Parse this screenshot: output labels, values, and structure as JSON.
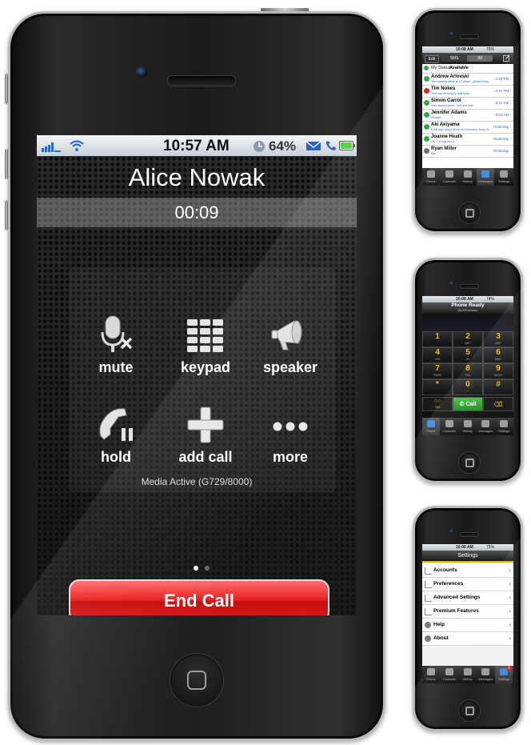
{
  "main_call": {
    "status_bar": {
      "time": "10:57 AM",
      "battery_pct": "64%"
    },
    "caller_name": "Alice Nowak",
    "duration": "00:09",
    "controls": {
      "mute": "mute",
      "keypad": "keypad",
      "speaker": "speaker",
      "hold": "hold",
      "add_call": "add call",
      "more": "more"
    },
    "media_status": "Media Active (G729/8000)",
    "end_call": "End Call",
    "page_indicator": {
      "pages": 2,
      "current": 1
    }
  },
  "messages_screen": {
    "status_time": "10:08 AM",
    "status_battery": "75%",
    "tabs": {
      "edit": "Edit",
      "sms": "SMS",
      "im": "IM"
    },
    "my_status_label": "My Status:",
    "my_status_value": "Available",
    "items": [
      {
        "name": "Andrew Arlovski",
        "preview": "The meeting starts at 10:45am - please bring...",
        "time": "2:48 PM",
        "status": "available"
      },
      {
        "name": "Tim Nokes",
        "preview": "They are arriving by helicopter",
        "time": "2:34 PM",
        "status": "busy"
      },
      {
        "name": "Simon Carrol",
        "preview": "Sure sounds great - see you then",
        "time": "8:24 AM",
        "status": "available"
      },
      {
        "name": "Jennifer Adams",
        "preview": "Finally!!!",
        "time": "8:03 AM",
        "status": "available"
      },
      {
        "name": "Aki Akiyama",
        "preview": "It will take about 40min and includes many of...",
        "time": "Yesterday",
        "status": "available"
      },
      {
        "name": "Joanne Heath",
        "preview": "OK - I'll look into it",
        "time": "Yesterday",
        "status": "available"
      },
      {
        "name": "Ryan Miller",
        "preview": "Bye",
        "time": "Yesterday",
        "status": "offline"
      }
    ],
    "tabbar": [
      "Phone",
      "Contacts",
      "History",
      "Messages",
      "Settings"
    ],
    "selected_tab": "Messages"
  },
  "dialpad_screen": {
    "status_time": "10:09 AM",
    "status_battery": "74%",
    "title": "Phone Ready",
    "subtitle": "My SIP Account",
    "keys": [
      {
        "digit": "1",
        "letters": ""
      },
      {
        "digit": "2",
        "letters": "ABC"
      },
      {
        "digit": "3",
        "letters": "DEF"
      },
      {
        "digit": "4",
        "letters": "GHI"
      },
      {
        "digit": "5",
        "letters": "JKL"
      },
      {
        "digit": "6",
        "letters": "MNO"
      },
      {
        "digit": "7",
        "letters": "PQRS"
      },
      {
        "digit": "8",
        "letters": "TUV"
      },
      {
        "digit": "9",
        "letters": "WXYZ"
      },
      {
        "digit": "*",
        "letters": ""
      },
      {
        "digit": "0",
        "letters": "+"
      },
      {
        "digit": "#",
        "letters": ""
      }
    ],
    "voicemail_label": "VM",
    "call_label": "Call",
    "tabbar": [
      "Phone",
      "Contacts",
      "History",
      "Messages",
      "Settings"
    ],
    "selected_tab": "Phone"
  },
  "settings_screen": {
    "status_time": "10:06 AM",
    "status_battery": "75%",
    "title": "Settings",
    "items": [
      "Accounts",
      "Preferences",
      "Advanced Settings",
      "Premium Features",
      "Help",
      "About"
    ],
    "tabbar": [
      "Phone",
      "Contacts",
      "History",
      "Messages",
      "Settings"
    ],
    "selected_tab": "Settings",
    "settings_badge": "1"
  },
  "colors": {
    "end_call_red": "#e01a1a",
    "dialpad_yellow": "#f2c200",
    "call_green": "#2fa12f",
    "status_blue": "#2d62c7",
    "available_green": "#2fa84a",
    "busy_red": "#d42424",
    "offline_grey": "#6d6d6d"
  }
}
